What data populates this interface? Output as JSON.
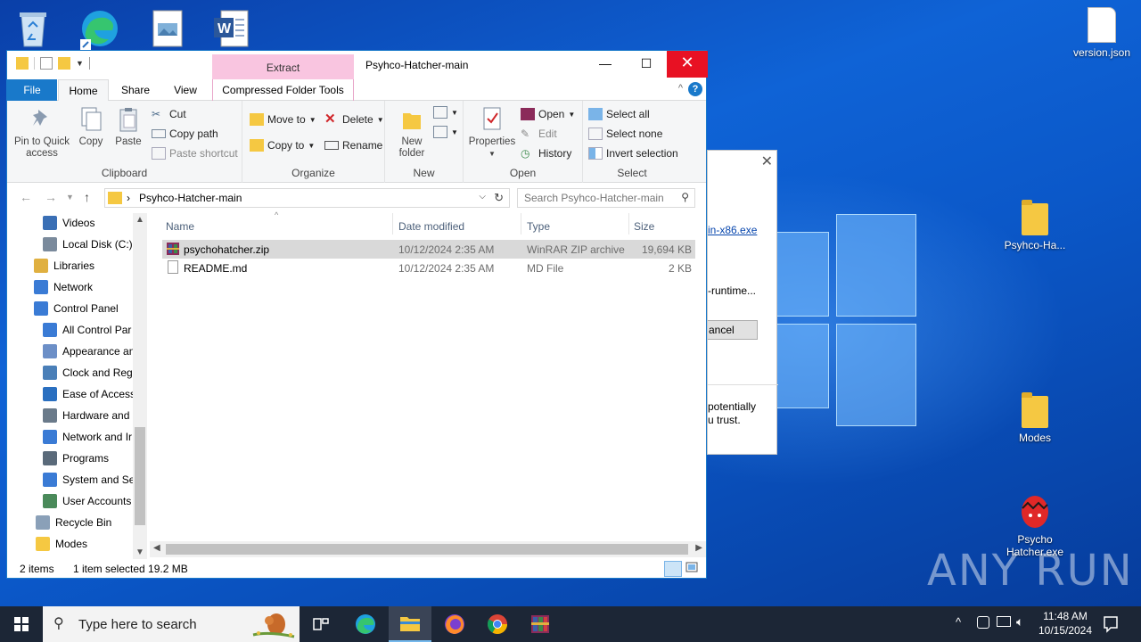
{
  "desktop": {
    "icons": [
      {
        "name": "version.json"
      },
      {
        "name": "Psyhco-Ha..."
      },
      {
        "name": "Modes"
      },
      {
        "name": "Psycho Hatcher.exe"
      }
    ],
    "watermark": "ANY RUN"
  },
  "background_dialog": {
    "link": "in-x86.exe",
    "text1": "-runtime...",
    "button": "ancel",
    "text2_line1": "potentially",
    "text2_line2": "u trust."
  },
  "explorer": {
    "title": "Psyhco-Hatcher-main",
    "context_tab_group": "Extract",
    "tabs": {
      "file": "File",
      "home": "Home",
      "share": "Share",
      "view": "View",
      "context": "Compressed Folder Tools"
    },
    "ribbon": {
      "clipboard": {
        "pin": "Pin to Quick access",
        "copy": "Copy",
        "paste": "Paste",
        "cut": "Cut",
        "copy_path": "Copy path",
        "paste_shortcut": "Paste shortcut",
        "label": "Clipboard"
      },
      "organize": {
        "move_to": "Move to",
        "copy_to": "Copy to",
        "delete": "Delete",
        "rename": "Rename",
        "label": "Organize"
      },
      "new": {
        "new_folder": "New folder",
        "label": "New"
      },
      "open": {
        "properties": "Properties",
        "open": "Open",
        "edit": "Edit",
        "history": "History",
        "label": "Open"
      },
      "select": {
        "select_all": "Select all",
        "select_none": "Select none",
        "invert": "Invert selection",
        "label": "Select"
      }
    },
    "address": {
      "crumb": "Psyhco-Hatcher-main",
      "search_placeholder": "Search Psyhco-Hatcher-main"
    },
    "nav_items": [
      {
        "label": "Videos",
        "color": "#3a6fb5"
      },
      {
        "label": "Local Disk (C:)",
        "color": "#7a8a9c"
      },
      {
        "label": "Libraries",
        "color": "#e0b040"
      },
      {
        "label": "Network",
        "color": "#3a7bd5"
      },
      {
        "label": "Control Panel",
        "color": "#3a7bd5"
      },
      {
        "label": "All Control Par",
        "color": "#3a7bd5"
      },
      {
        "label": "Appearance an",
        "color": "#6c8fc7"
      },
      {
        "label": "Clock and Regi",
        "color": "#4a7fb8"
      },
      {
        "label": "Ease of Access",
        "color": "#2a6fc0"
      },
      {
        "label": "Hardware and",
        "color": "#6a7a8a"
      },
      {
        "label": "Network and Ir",
        "color": "#3a7bd5"
      },
      {
        "label": "Programs",
        "color": "#5a6a7a"
      },
      {
        "label": "System and Sec",
        "color": "#3a7bd5"
      },
      {
        "label": "User Accounts",
        "color": "#4a8a5a"
      },
      {
        "label": "Recycle Bin",
        "color": "#8aa0b8"
      },
      {
        "label": "Modes",
        "color": "#f5c842"
      }
    ],
    "columns": {
      "name": "Name",
      "date": "Date modified",
      "type": "Type",
      "size": "Size"
    },
    "files": [
      {
        "name": "psychohatcher.zip",
        "date": "10/12/2024 2:35 AM",
        "type": "WinRAR ZIP archive",
        "size": "19,694 KB"
      },
      {
        "name": "README.md",
        "date": "10/12/2024 2:35 AM",
        "type": "MD File",
        "size": "2 KB"
      }
    ],
    "status": {
      "count": "2 items",
      "selected": "1 item selected  19.2 MB"
    }
  },
  "taskbar": {
    "search_placeholder": "Type here to search",
    "time": "11:48 AM",
    "date": "10/15/2024"
  }
}
